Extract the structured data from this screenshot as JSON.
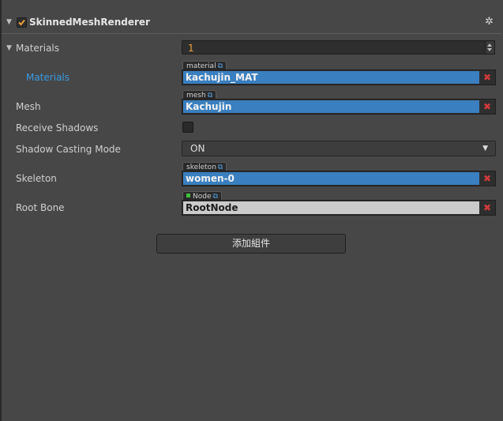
{
  "component": {
    "title": "SkinnedMeshRenderer",
    "enabled": true
  },
  "properties": {
    "materials_label": "Materials",
    "materials_count": "1",
    "material_item_label": "Materials",
    "material_tag": "material",
    "material_value": "kachujin_MAT",
    "mesh_label": "Mesh",
    "mesh_tag": "mesh",
    "mesh_value": "Kachujin",
    "receive_shadows_label": "Receive Shadows",
    "receive_shadows_checked": false,
    "shadow_casting_label": "Shadow Casting Mode",
    "shadow_casting_value": "ON",
    "skeleton_label": "Skeleton",
    "skeleton_tag": "skeleton",
    "skeleton_value": "women-0",
    "root_bone_label": "Root Bone",
    "root_bone_tag": "Node",
    "root_bone_value": "RootNode"
  },
  "add_component_label": "添加組件",
  "icons": {
    "collapse": "triangle-down-icon",
    "settings": "gear-icon",
    "link": "external-link-icon",
    "clear": "clear-x-icon",
    "dropdown": "dropdown-arrow-icon"
  },
  "colors": {
    "background": "#474747",
    "asset_field": "#3a7fbf",
    "node_field": "#cbcbcb",
    "label_blue": "#3a9be0",
    "number": "#f0a23b",
    "clear": "#d23a3a"
  }
}
